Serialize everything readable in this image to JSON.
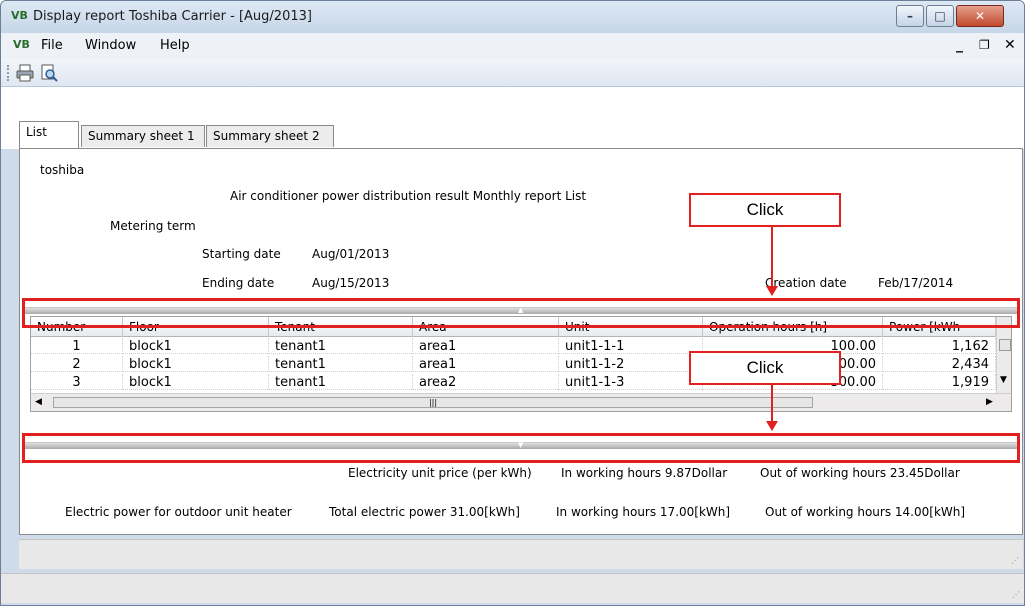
{
  "window": {
    "title": "Display report  Toshiba Carrier - [Aug/2013]",
    "app_icon": "VB",
    "min_glyph": "–",
    "max_glyph": "□",
    "close_glyph": "✕"
  },
  "menu": {
    "file": "File",
    "window": "Window",
    "help": "Help",
    "mdi_min": "_",
    "mdi_restore": "❐",
    "mdi_close": "✕"
  },
  "toolbar": {
    "print_icon": "printer-icon",
    "preview_icon": "print-preview-icon"
  },
  "tabs": [
    {
      "label": "List"
    },
    {
      "label": "Summary sheet 1"
    },
    {
      "label": "Summary sheet 2"
    }
  ],
  "report": {
    "company": "toshiba",
    "heading": "Air conditioner power distribution result  Monthly report List",
    "metering_term": "Metering term",
    "starting_label": "Starting date",
    "starting_value": "Aug/01/2013",
    "ending_label": "Ending date",
    "ending_value": "Aug/15/2013",
    "creation_label": "Creation date",
    "creation_value": "Feb/17/2014"
  },
  "grid": {
    "columns": [
      "Number",
      "Floor",
      "Tenant",
      "Area",
      "Unit",
      "Operation hours [h]",
      "Power [kWh"
    ],
    "rows": [
      [
        "1",
        "block1",
        "tenant1",
        "area1",
        "unit1-1-1",
        "100.00",
        "1,162"
      ],
      [
        "2",
        "block1",
        "tenant1",
        "area1",
        "unit1-1-2",
        "200.00",
        "2,434"
      ],
      [
        "3",
        "block1",
        "tenant1",
        "area2",
        "unit1-1-3",
        "300.00",
        "1,919"
      ]
    ],
    "hscroll_thumb": "|||"
  },
  "footer": {
    "price_label": "Electricity unit price (per kWh)",
    "price_in": "In working hours 9.87Dollar",
    "price_out": "Out of working hours 23.45Dollar",
    "heater_label": "Electric power for outdoor unit heater",
    "heater_total": "Total electric power 31.00[kWh]",
    "heater_in": "In working hours 17.00[kWh]",
    "heater_out": "Out of working hours 14.00[kWh]"
  },
  "annotations": {
    "click1": "Click",
    "click2": "Click"
  },
  "colors": {
    "annotation_red": "#e32020"
  }
}
